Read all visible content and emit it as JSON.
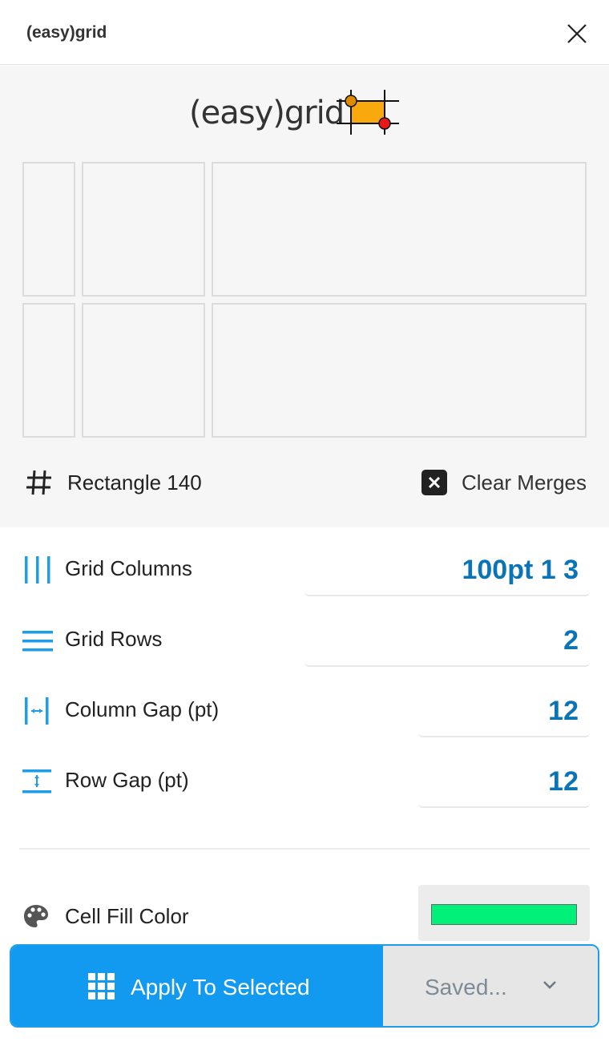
{
  "window": {
    "title": "(easy)grid"
  },
  "preview": {
    "logo_text": "(easy)grid",
    "frame_name": "Rectangle 140",
    "clear_label": "Clear Merges"
  },
  "props": {
    "columns": {
      "label": "Grid Columns",
      "value": "100pt 1 3"
    },
    "rows": {
      "label": "Grid Rows",
      "value": "2"
    },
    "col_gap": {
      "label": "Column Gap (pt)",
      "value": "12"
    },
    "row_gap": {
      "label": "Row Gap (pt)",
      "value": "12"
    }
  },
  "fill": {
    "label": "Cell Fill Color",
    "color": "#00f07a"
  },
  "actions": {
    "apply_label": "Apply To Selected",
    "saved_label": "Saved..."
  },
  "colors": {
    "accent": "#129af0",
    "value_text": "#0b74b5",
    "icon_blue": "#1e9ee8"
  },
  "icons": {
    "close": "close-icon",
    "logo": "easygrid-logo-icon",
    "frame": "hash-icon",
    "clear": "close-box-icon",
    "columns": "columns-icon",
    "rows": "rows-icon",
    "col_gap": "column-gap-icon",
    "row_gap": "row-gap-icon",
    "palette": "palette-icon",
    "grid": "grid-icon",
    "chevron": "chevron-down-icon"
  }
}
